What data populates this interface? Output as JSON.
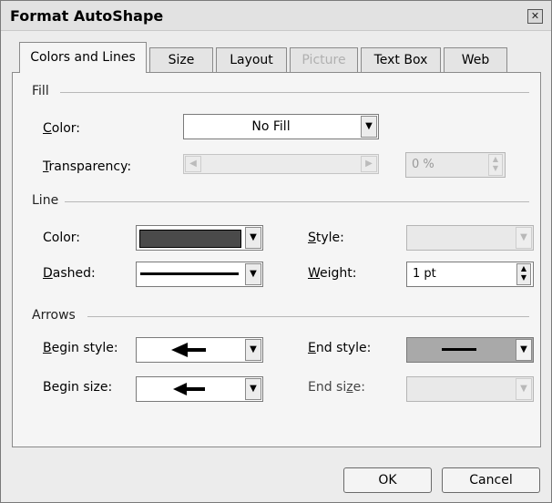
{
  "dialog": {
    "title": "Format AutoShape",
    "close_glyph": "✕"
  },
  "tabs": [
    {
      "label": "Colors and Lines",
      "active": true,
      "enabled": true
    },
    {
      "label": "Size",
      "active": false,
      "enabled": true
    },
    {
      "label": "Layout",
      "active": false,
      "enabled": true
    },
    {
      "label": "Picture",
      "active": false,
      "enabled": false
    },
    {
      "label": "Text Box",
      "active": false,
      "enabled": true
    },
    {
      "label": "Web",
      "active": false,
      "enabled": true
    }
  ],
  "fill": {
    "section_label": "Fill",
    "color_label_u": "C",
    "color_label_rest": "olor:",
    "color_value": "No Fill",
    "transparency_label_u": "T",
    "transparency_label_rest": "ransparency:",
    "transparency_value": "0 %",
    "transparency_enabled": false
  },
  "line": {
    "section_label": "Line",
    "color_label": "Color:",
    "color_value_hex": "#4a4a4a",
    "dashed_label_u": "D",
    "dashed_label_rest": "ashed:",
    "style_label_u": "S",
    "style_label_rest": "tyle:",
    "style_enabled": false,
    "weight_label_u": "W",
    "weight_label_rest": "eight:",
    "weight_value": "1 pt"
  },
  "arrows": {
    "section_label": "Arrows",
    "begin_style_label_u": "B",
    "begin_style_label_rest": "egin style:",
    "begin_size_label": "Begin size:",
    "end_style_label_u": "E",
    "end_style_label_rest": "nd style:",
    "end_size_label_pre": "End si",
    "end_size_label_u": "z",
    "end_size_label_rest": "e:",
    "end_size_enabled": false
  },
  "buttons": {
    "ok": "OK",
    "cancel": "Cancel"
  },
  "icons": {
    "dropdown": "chevron-down-icon",
    "scroll_left": "chevron-left-icon",
    "scroll_right": "chevron-right-icon",
    "spin_up": "triangle-up-icon",
    "spin_down": "triangle-down-icon",
    "arrow_left": "left-arrow-icon",
    "close": "close-icon"
  }
}
